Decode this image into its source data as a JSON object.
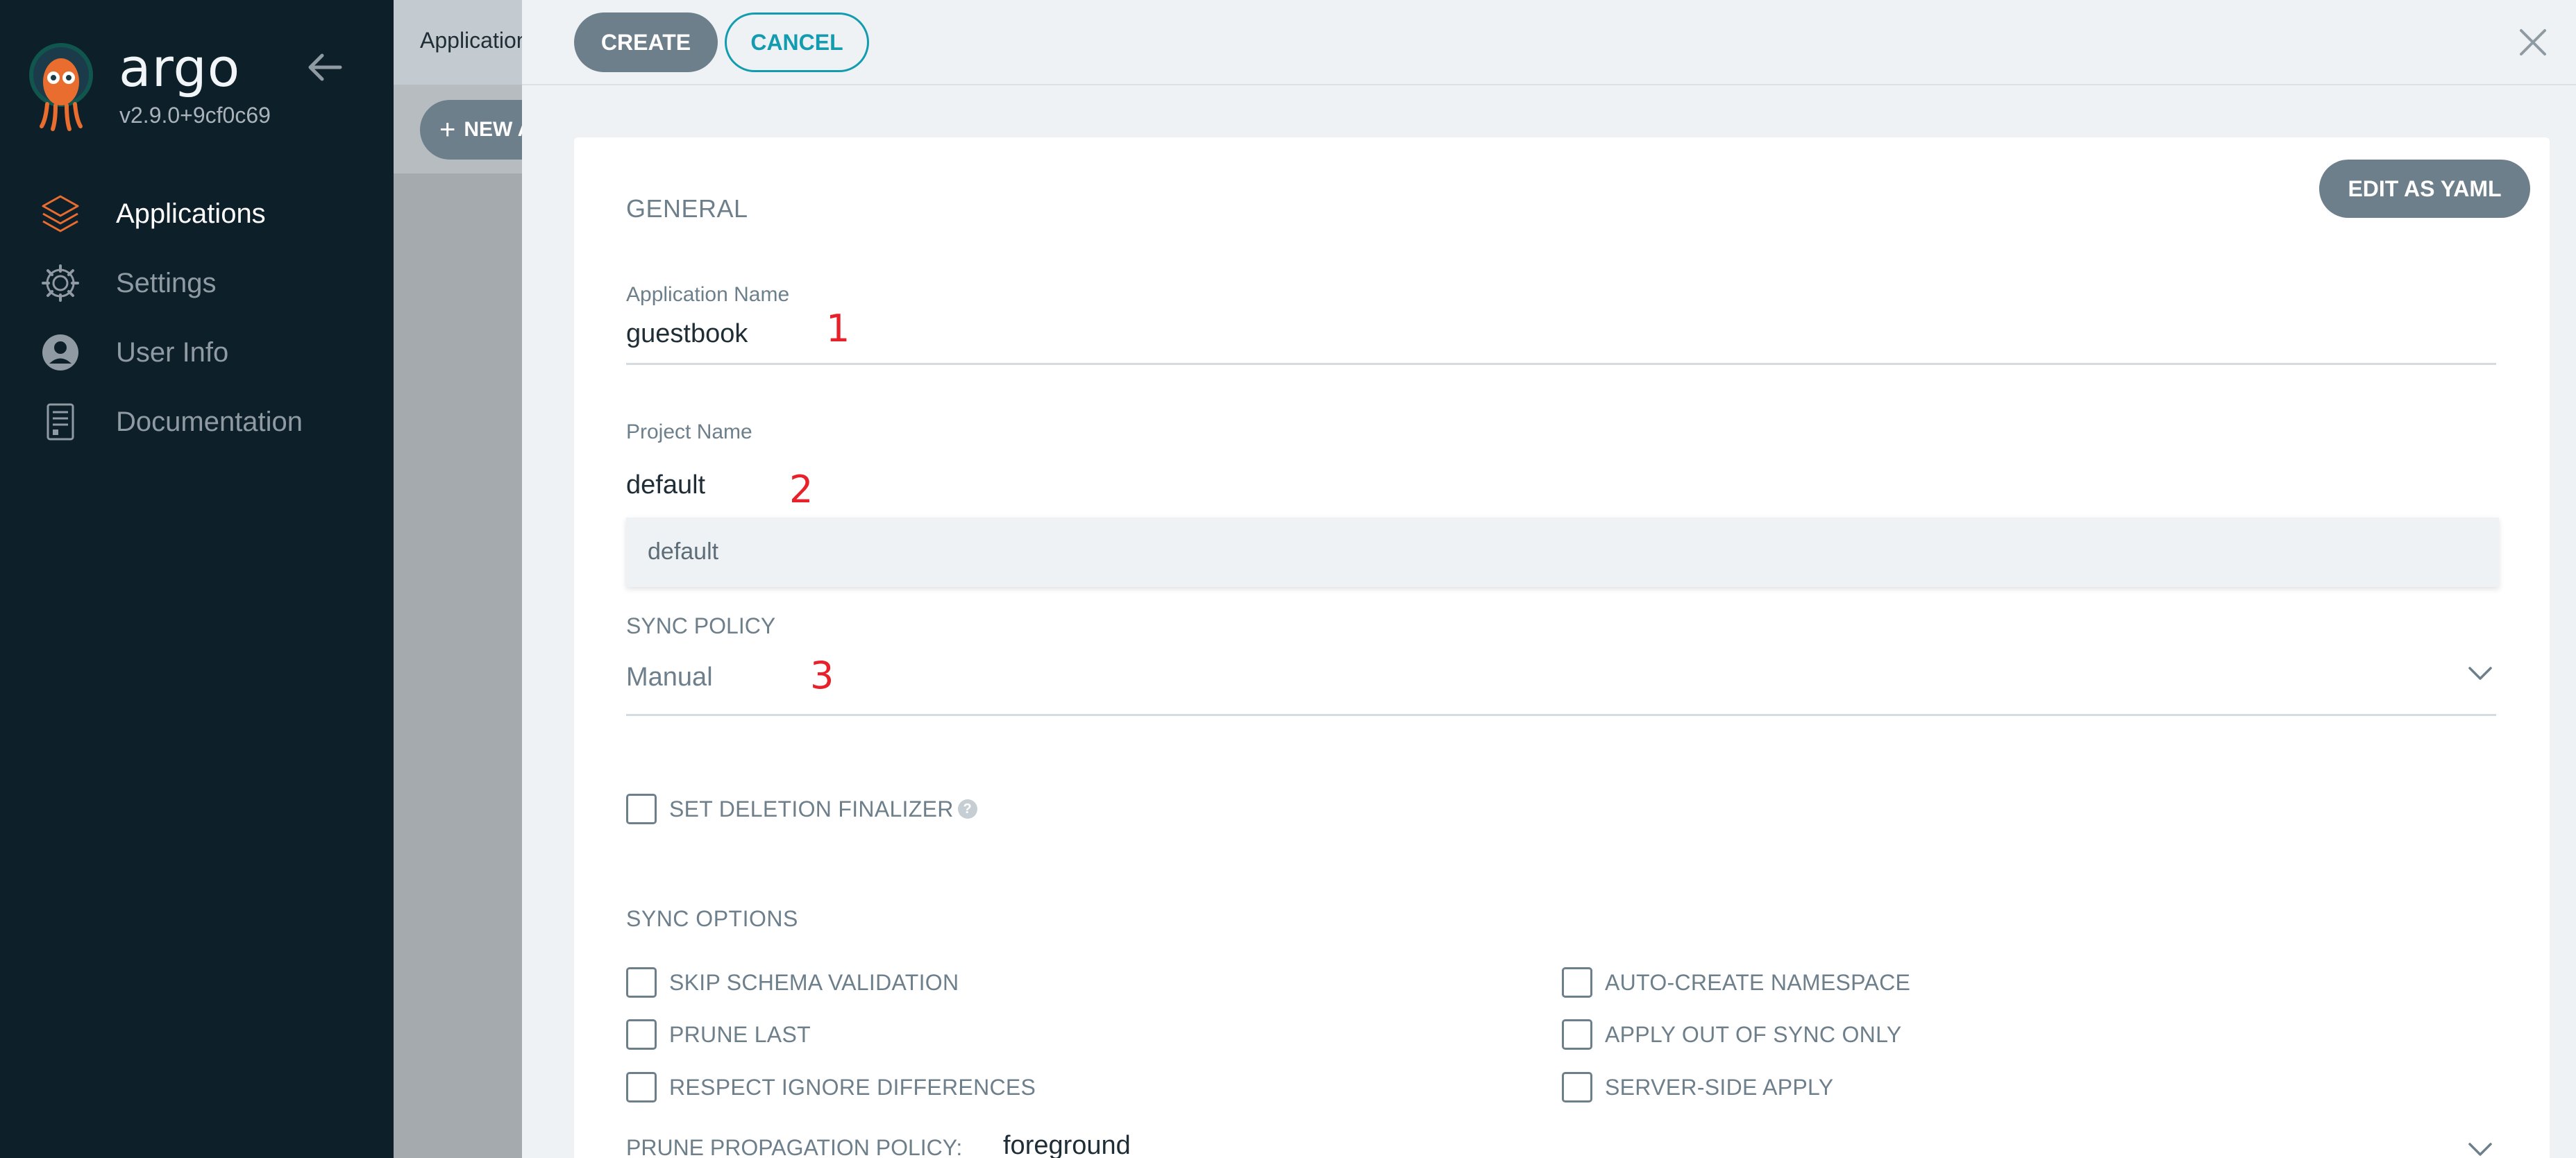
{
  "sidebar": {
    "brand": "argo",
    "version": "v2.9.0+9cf0c69",
    "items": [
      {
        "label": "Applications",
        "icon": "layers-icon",
        "active": true
      },
      {
        "label": "Settings",
        "icon": "gear-icon",
        "active": false
      },
      {
        "label": "User Info",
        "icon": "user-icon",
        "active": false
      },
      {
        "label": "Documentation",
        "icon": "document-icon",
        "active": false
      }
    ]
  },
  "background": {
    "page_title": "Applications",
    "new_app_label": "NEW APP"
  },
  "panel": {
    "create_label": "CREATE",
    "cancel_label": "CANCEL",
    "edit_yaml_label": "EDIT AS YAML",
    "general": {
      "title": "GENERAL",
      "app_name_label": "Application Name",
      "app_name_value": "guestbook",
      "project_name_label": "Project Name",
      "project_name_value": "default",
      "project_options": [
        "default"
      ],
      "sync_policy_label": "SYNC POLICY",
      "sync_policy_value": "Manual",
      "set_deletion_finalizer": "SET DELETION FINALIZER"
    },
    "sync_options": {
      "title": "SYNC OPTIONS",
      "left": [
        "SKIP SCHEMA VALIDATION",
        "PRUNE LAST",
        "RESPECT IGNORE DIFFERENCES"
      ],
      "right": [
        "AUTO-CREATE NAMESPACE",
        "APPLY OUT OF SYNC ONLY",
        "SERVER-SIDE APPLY"
      ],
      "prune_policy_label": "PRUNE PROPAGATION POLICY:",
      "prune_policy_value": "foreground"
    },
    "annotations": [
      "1",
      "2",
      "3"
    ]
  },
  "colors": {
    "sidebar_bg": "#0d1f29",
    "accent_orange": "#e96d2f",
    "button_gray": "#6d7f8b",
    "cancel_teal": "#139bb0",
    "annotation_red": "#e8202a"
  }
}
